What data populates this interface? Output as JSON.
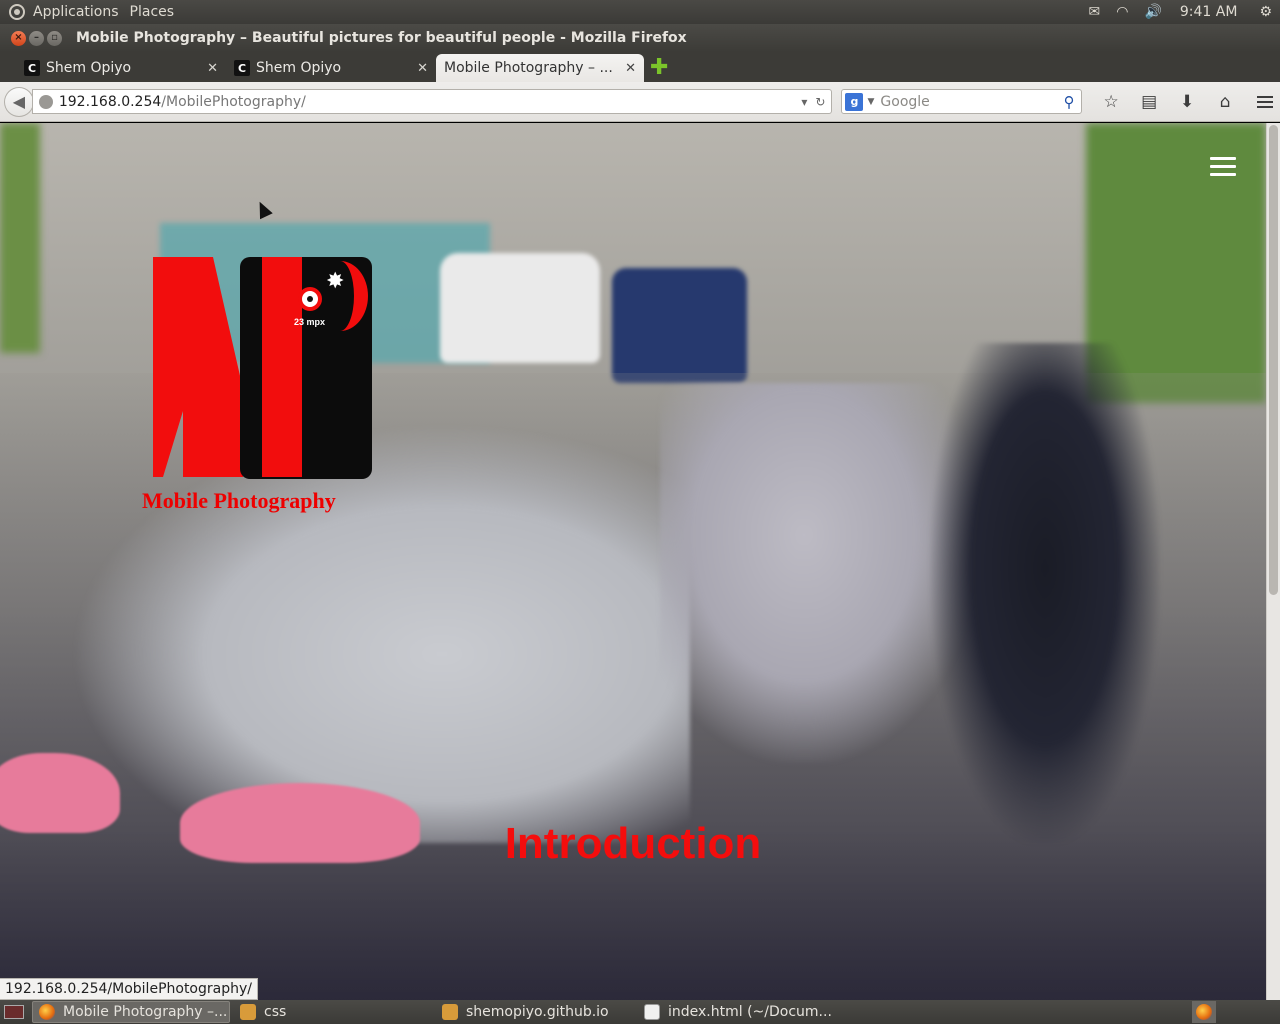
{
  "system_panel": {
    "menus": [
      "Applications",
      "Places"
    ],
    "clock": "9:41 AM",
    "tray_icons": [
      "mail-icon",
      "wifi-icon",
      "volume-icon",
      "gear-icon"
    ]
  },
  "window": {
    "title": "Mobile Photography – Beautiful pictures for beautiful people - Mozilla Firefox"
  },
  "tabs": [
    {
      "favicon": "C",
      "title": "Shem Opiyo",
      "active": false
    },
    {
      "favicon": "C",
      "title": "Shem Opiyo",
      "active": false
    },
    {
      "favicon": "",
      "title": "Mobile Photography – ...",
      "active": true
    }
  ],
  "navbar": {
    "url_host": "192.168.0.254",
    "url_path": "/MobilePhotography/",
    "search_placeholder": "Google",
    "search_engine": "g"
  },
  "page": {
    "logo_brand": "Mobile Photography",
    "logo_badge": "23 mpx",
    "heading": "Introduction",
    "accent_color": "#f20d0d"
  },
  "status_bar": {
    "link_url": "192.168.0.254/MobilePhotography/"
  },
  "taskbar": {
    "items": [
      {
        "label": "Mobile Photography –...",
        "icon": "firefox-icon",
        "active": true
      },
      {
        "label": "css",
        "icon": "folder-icon",
        "active": false
      },
      {
        "label": "shemopiyo.github.io",
        "icon": "folder-icon",
        "active": false
      },
      {
        "label": "index.html (~/Docum...",
        "icon": "document-icon",
        "active": false
      }
    ]
  }
}
